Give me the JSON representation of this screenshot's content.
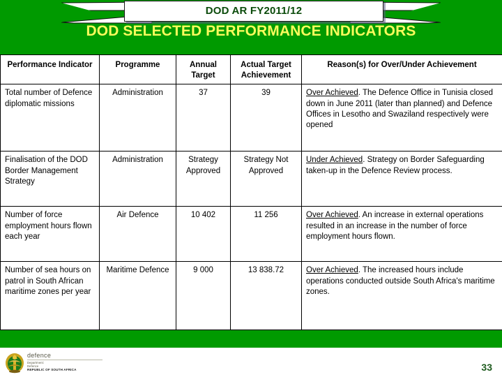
{
  "banner": {
    "title": "DOD AR FY2011/12",
    "left_tail_icon": "ribbon-tail-left-icon",
    "right_tail_icon": "ribbon-tail-right-icon"
  },
  "slide": {
    "title": "DOD SELECTED PERFORMANCE INDICATORS",
    "background_color": "#009A00",
    "title_color": "#FBFB5C",
    "banner_text_color": "#0B4B0B"
  },
  "table": {
    "headers": [
      "Performance Indicator",
      "Programme",
      "Annual Target",
      "Actual Target Achievement",
      "Reason(s) for Over/Under Achievement"
    ],
    "rows": [
      {
        "indicator": "Total number of Defence diplomatic missions",
        "programme": "Administration",
        "annual_target": "37",
        "actual_achievement": "39",
        "verdict": "Over Achieved",
        "reason": ".  The Defence Office in Tunisia closed down in June 2011 (later than planned) and Defence Offices in Lesotho and Swaziland respectively were opened"
      },
      {
        "indicator": "Finalisation of the DOD Border Management Strategy",
        "programme": "Administration",
        "annual_target": "Strategy Approved",
        "actual_achievement": "Strategy Not Approved",
        "verdict": "Under Achieved",
        "reason": ".  Strategy on Border Safeguarding taken-up in the Defence Review process."
      },
      {
        "indicator": "Number of force employment hours flown each year",
        "programme": "Air Defence",
        "annual_target": "10 402",
        "actual_achievement": "11 256",
        "verdict": "Over Achieved",
        "reason": ".  An increase in external operations resulted in an increase in the number of force employment hours flown."
      },
      {
        "indicator": "Number of sea hours on patrol in South African maritime zones per year",
        "programme": "Maritime Defence",
        "annual_target": "9 000",
        "actual_achievement": "13 838.72",
        "verdict": "Over Achieved",
        "reason": ".  The increased hours include operations conducted outside South Africa's maritime zones."
      }
    ]
  },
  "footer": {
    "logo_word": "defence",
    "logo_line1": "Department:",
    "logo_line2": "Defence",
    "logo_republic": "REPUBLIC OF SOUTH AFRICA",
    "logo_crest_icon": "south-africa-coat-of-arms-icon",
    "page_number": "33"
  }
}
